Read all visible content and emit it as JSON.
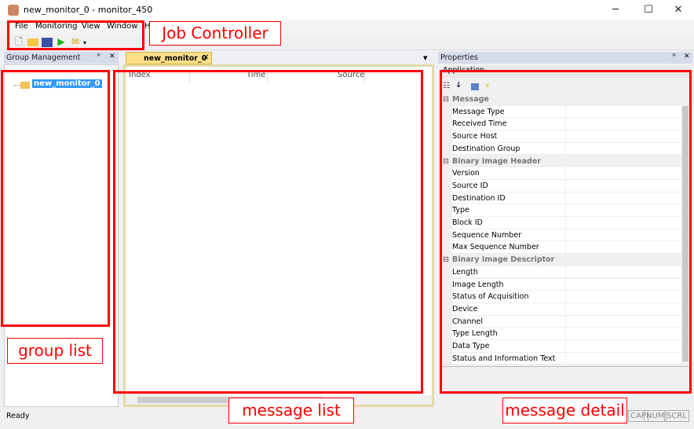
{
  "window": {
    "title": "new_monitor_0 - monitor_450",
    "minimize": "─",
    "maximize": "☐",
    "close": "✕"
  },
  "menu": [
    "File",
    "Monitoring",
    "View",
    "Window",
    "H"
  ],
  "toolbar": {
    "icons": [
      "new-icon",
      "open-icon",
      "save-icon",
      "play-icon",
      "export-icon"
    ]
  },
  "group_panel": {
    "title": "Group Management",
    "pin": "ᵖ",
    "close": "✕",
    "tree_item": "new_monitor_0"
  },
  "document": {
    "tab": "new_monitor_0",
    "tab_close": "✕",
    "dropdown": "▾",
    "columns": [
      "Index",
      "Time",
      "Source"
    ]
  },
  "properties": {
    "title": "Properties",
    "pin": "ᵖ",
    "close": "✕",
    "object": "Application",
    "rows": [
      {
        "cat": true,
        "name": "Message"
      },
      {
        "name": "Message Type"
      },
      {
        "name": "Received Time"
      },
      {
        "name": "Source Host"
      },
      {
        "name": "Destination Group"
      },
      {
        "cat": true,
        "name": "Binary Image Header"
      },
      {
        "name": "Version"
      },
      {
        "name": "Source ID"
      },
      {
        "name": "Destination ID"
      },
      {
        "name": "Type"
      },
      {
        "name": "Block ID"
      },
      {
        "name": "Sequence Number"
      },
      {
        "name": "Max Sequence Number"
      },
      {
        "cat": true,
        "name": "Binary Image Descriptor"
      },
      {
        "name": "Length"
      },
      {
        "name": "Image Length"
      },
      {
        "name": "Status of Acquisition"
      },
      {
        "name": "Device"
      },
      {
        "name": "Channel"
      },
      {
        "name": "Type Length"
      },
      {
        "name": "Data Type"
      },
      {
        "name": "Status and Information Text"
      }
    ]
  },
  "statusbar": {
    "text": "Ready",
    "keys": [
      "CAP",
      "NUM",
      "SCRL"
    ]
  },
  "annotations": {
    "job_controller": "Job Controller",
    "group_list": "group  list",
    "message_list": "message  list",
    "message_detail": "message  detail"
  },
  "colors": {
    "annotation": "#ff0000",
    "selection": "#3399ff",
    "tab": "#ffe08a"
  }
}
